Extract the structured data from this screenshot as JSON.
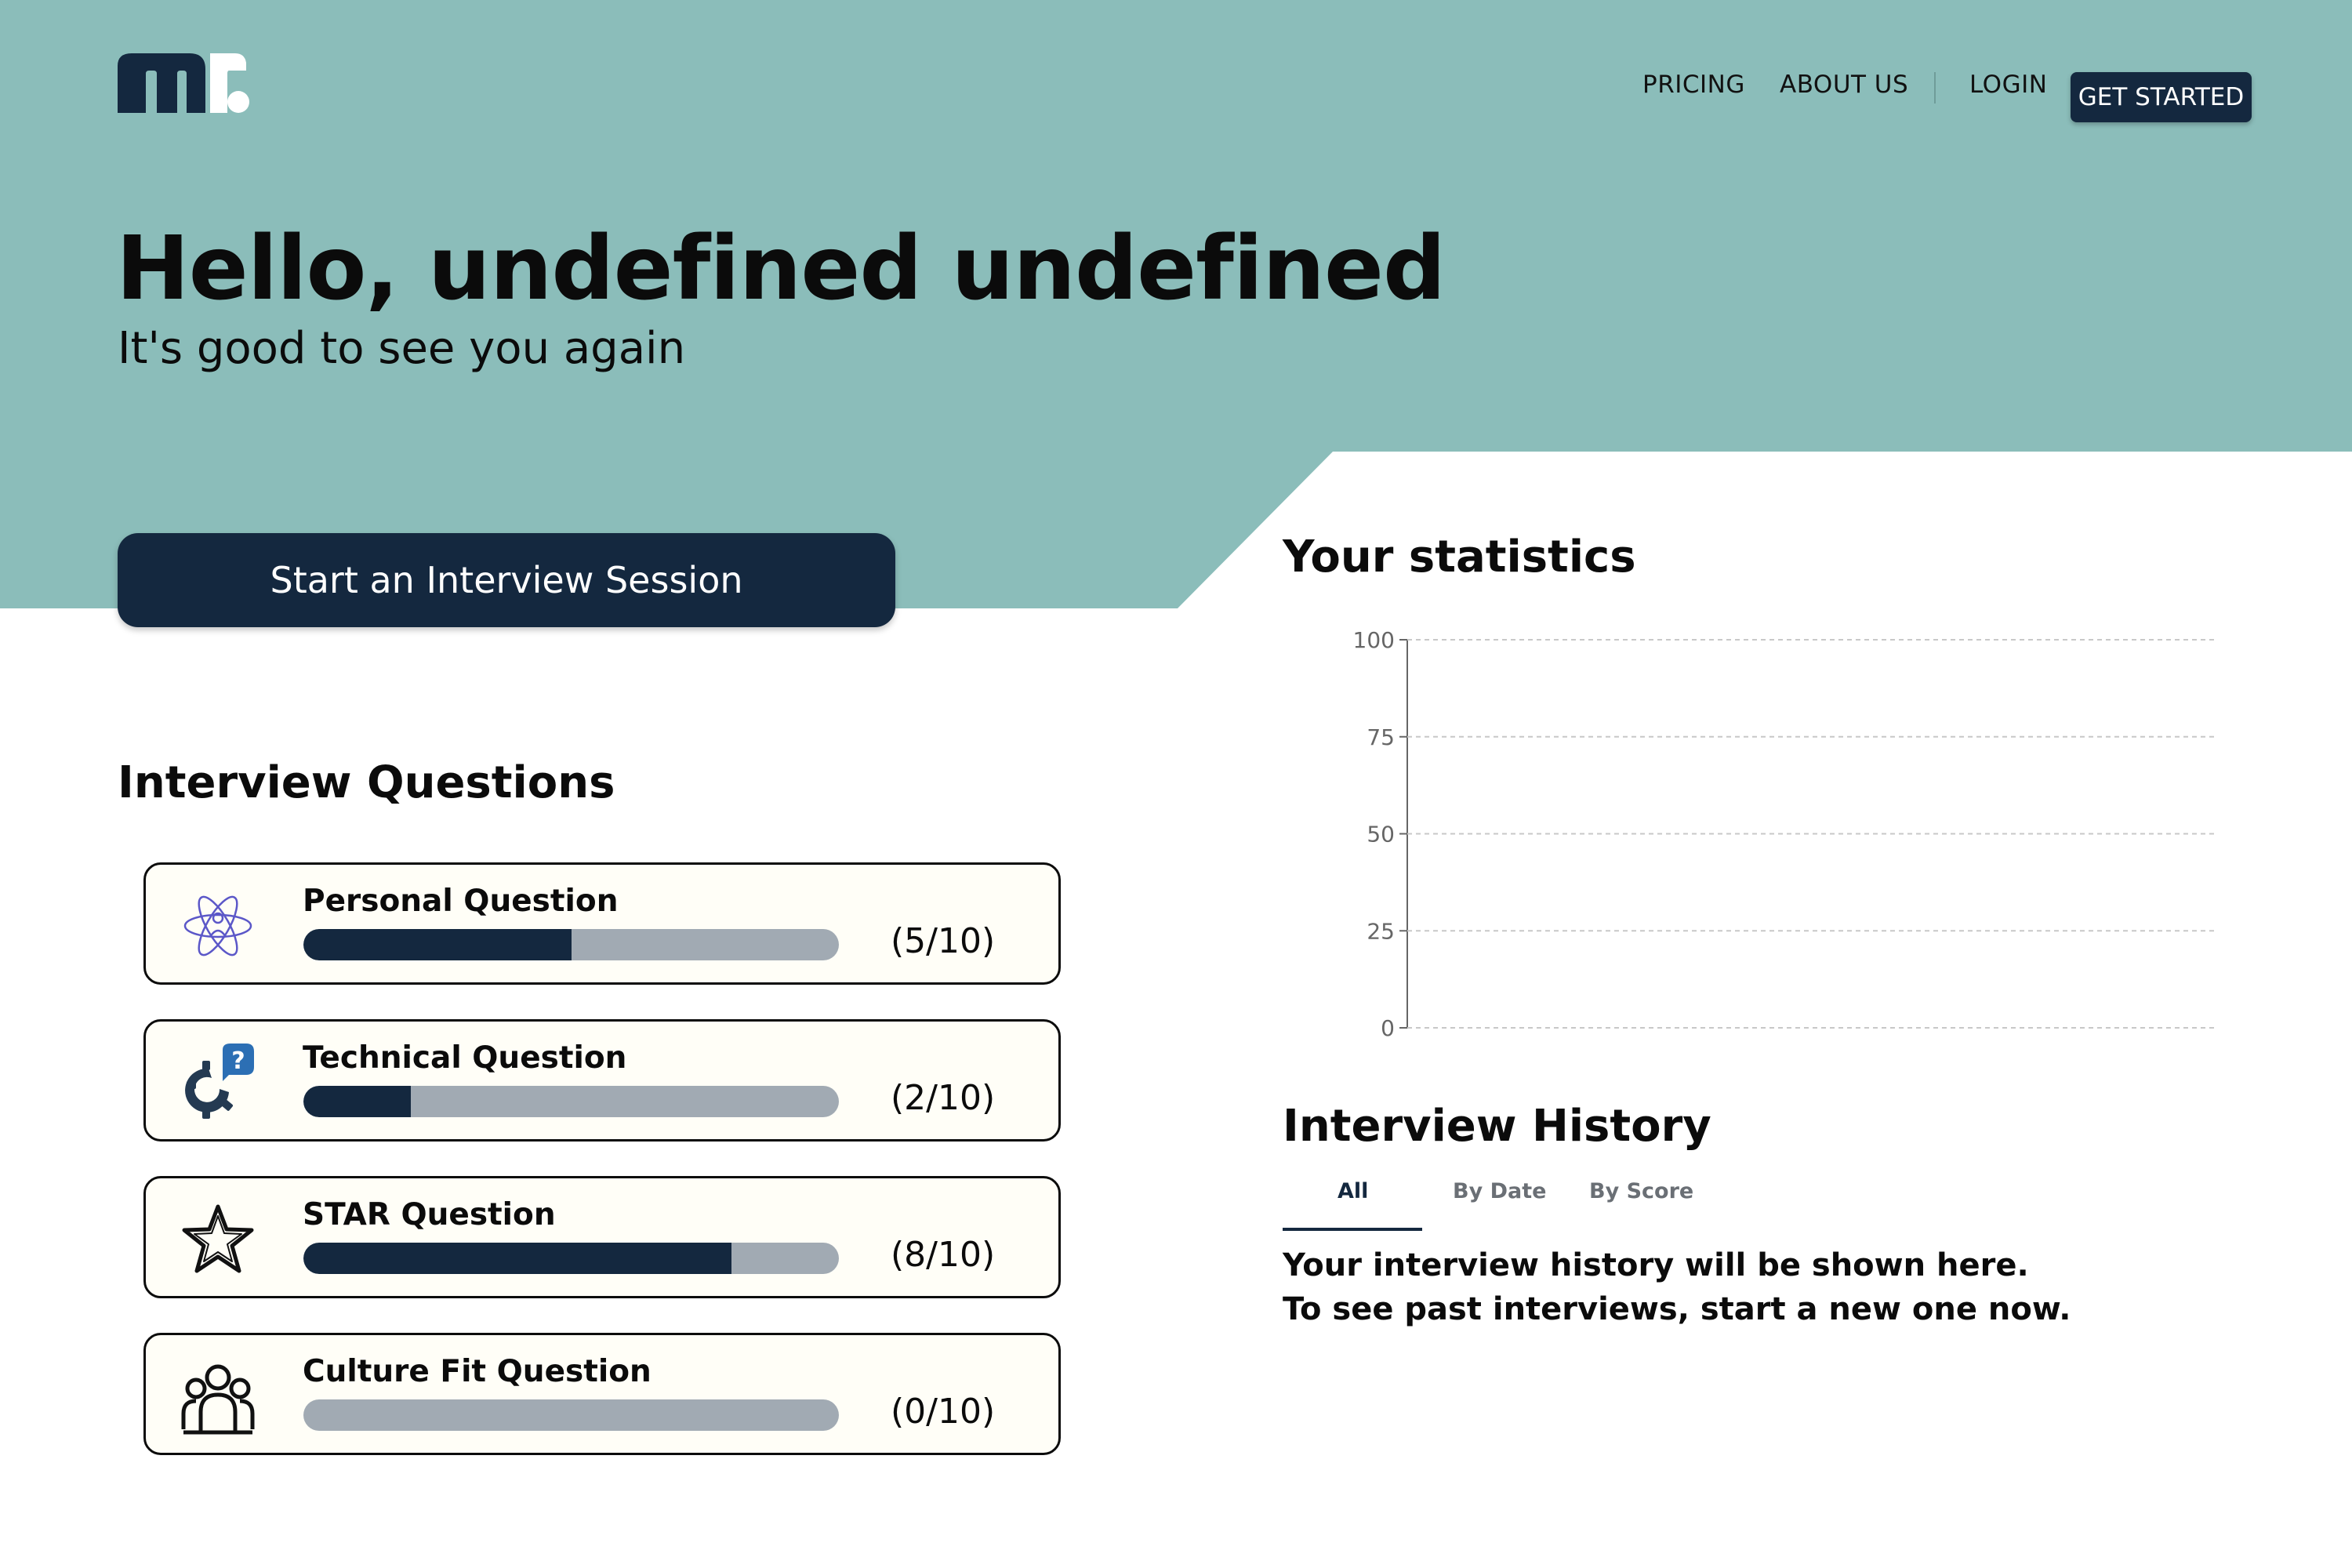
{
  "header": {
    "logo_text": "mr.",
    "nav": {
      "pricing": "PRICING",
      "about": "ABOUT US",
      "login": "LOGIN",
      "get_started": "GET STARTED"
    }
  },
  "hero": {
    "greeting": "Hello, undefined undefined",
    "subtitle": "It's good to see you again",
    "start_button": "Start an Interview Session"
  },
  "colors": {
    "accent": "#14283f",
    "hero_bg": "#8bbdba",
    "card_bg": "#fffef7",
    "bar_track": "#a1aab3"
  },
  "questions": {
    "title": "Interview Questions",
    "items": [
      {
        "label": "Personal Question",
        "count": "(5/10)",
        "progress": 0.5,
        "icon": "atom-person-icon"
      },
      {
        "label": "Technical Question",
        "count": "(2/10)",
        "progress": 0.2,
        "icon": "gear-question-icon"
      },
      {
        "label": "STAR Question",
        "count": "(8/10)",
        "progress": 0.8,
        "icon": "star-icon"
      },
      {
        "label": "Culture Fit Question",
        "count": "(0/10)",
        "progress": 0.0,
        "icon": "group-icon"
      }
    ]
  },
  "statistics": {
    "title": "Your statistics"
  },
  "chart_data": {
    "type": "line",
    "title": "",
    "xlabel": "",
    "ylabel": "",
    "ylim": [
      0,
      100
    ],
    "yticks": [
      "0",
      "25",
      "50",
      "75",
      "100"
    ],
    "series": [],
    "grid": true
  },
  "history": {
    "title": "Interview History",
    "tabs": [
      "All",
      "By Date",
      "By Score"
    ],
    "active_tab": "All",
    "message_line1": "Your interview history will be shown here.",
    "message_line2": "To see past interviews, start a new one now."
  }
}
